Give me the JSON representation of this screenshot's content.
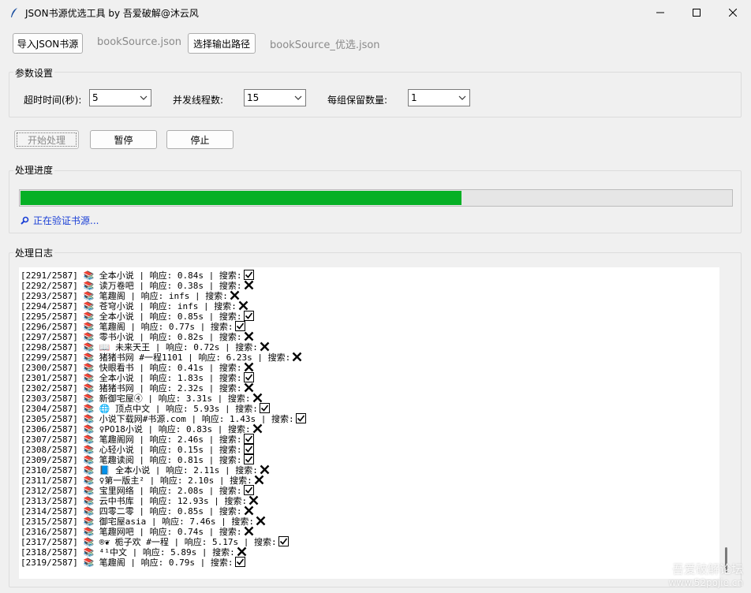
{
  "window": {
    "title": "JSON书源优选工具 by 吾爱破解@沐云风"
  },
  "toolbar": {
    "import_label": "导入JSON书源",
    "input_file": "bookSource.json",
    "output_label": "选择输出路径",
    "output_file": "bookSource_优选.json"
  },
  "params": {
    "group_title": "参数设置",
    "timeout_label": "超时时间(秒):",
    "timeout_value": "5",
    "threads_label": "并发线程数:",
    "threads_value": "15",
    "keep_label": "每组保留数量:",
    "keep_value": "1"
  },
  "controls": {
    "start_label": "开始处理",
    "pause_label": "暂停",
    "stop_label": "停止"
  },
  "progress": {
    "group_title": "处理进度",
    "fraction": 0.619,
    "status_text": "正在验证书源...",
    "accent": "#06b025"
  },
  "log": {
    "group_title": "处理日志",
    "lines": [
      {
        "text": "[2291/2587] 📚 全本小说 | 响应: 0.84s | 搜索:",
        "ok": true
      },
      {
        "text": "[2292/2587] 📚 读万卷吧 | 响应: 0.38s | 搜索:",
        "ok": false
      },
      {
        "text": "[2293/2587] 📚 笔趣阁 | 响应: infs | 搜索:",
        "ok": false
      },
      {
        "text": "[2294/2587] 📚 苍穹小说 | 响应: infs | 搜索:",
        "ok": false
      },
      {
        "text": "[2295/2587] 📚 全本小说 | 响应: 0.85s | 搜索:",
        "ok": true
      },
      {
        "text": "[2296/2587] 📚 笔趣阁 | 响应: 0.77s | 搜索:",
        "ok": true
      },
      {
        "text": "[2297/2587] 📚 零书小说 | 响应: 0.82s | 搜索:",
        "ok": false
      },
      {
        "text": "[2298/2587] 📚 📖 未来天王 | 响应: 0.72s | 搜索:",
        "ok": false
      },
      {
        "text": "[2299/2587] 📚 猪猪书网 #一程1101 | 响应: 6.23s | 搜索:",
        "ok": false
      },
      {
        "text": "[2300/2587] 📚 快眼看书 | 响应: 0.41s | 搜索:",
        "ok": false
      },
      {
        "text": "[2301/2587] 📚 全本小说 | 响应: 1.83s | 搜索:",
        "ok": true
      },
      {
        "text": "[2302/2587] 📚 猪猪书网 | 响应: 2.32s | 搜索:",
        "ok": false
      },
      {
        "text": "[2303/2587] 📚 新御宅屋④ | 响应: 3.31s | 搜索:",
        "ok": false
      },
      {
        "text": "[2304/2587] 📚 🌐 顶点中文 | 响应: 5.93s | 搜索:",
        "ok": true
      },
      {
        "text": "[2305/2587] 📚 小说下载网#书源.com | 响应: 1.43s | 搜索:",
        "ok": true
      },
      {
        "text": "[2306/2587] 📚 ♀PO18小说 | 响应: 0.83s | 搜索:",
        "ok": false
      },
      {
        "text": "[2307/2587] 📚 笔趣阁网 | 响应: 2.46s | 搜索:",
        "ok": true
      },
      {
        "text": "[2308/2587] 📚 心轻小说 | 响应: 0.15s | 搜索:",
        "ok": true
      },
      {
        "text": "[2309/2587] 📚 笔趣读阅 | 响应: 0.81s | 搜索:",
        "ok": true
      },
      {
        "text": "[2310/2587] 📚 📘 全本小说 | 响应: 2.11s | 搜索:",
        "ok": false
      },
      {
        "text": "[2311/2587] 📚 ♀第一版主² | 响应: 2.10s | 搜索:",
        "ok": false
      },
      {
        "text": "[2312/2587] 📚 宝里网络 | 响应: 2.08s | 搜索:",
        "ok": true
      },
      {
        "text": "[2313/2587] 📚 云中书库 | 响应: 12.93s | 搜索:",
        "ok": false
      },
      {
        "text": "[2314/2587] 📚 四零二零 | 响应: 0.85s | 搜索:",
        "ok": false
      },
      {
        "text": "[2315/2587] 📚 御宅屋asia | 响应: 7.46s | 搜索:",
        "ok": false
      },
      {
        "text": "[2316/2587] 📚 笔趣网吧 | 响应: 0.74s | 搜索:",
        "ok": false
      },
      {
        "text": "[2317/2587] 📚 ®❦ 栀子欢 #一程 | 响应: 5.17s | 搜索:",
        "ok": true
      },
      {
        "text": "[2318/2587] 📚 ⁴¹中文 | 响应: 5.89s | 搜索:",
        "ok": false
      },
      {
        "text": "[2319/2587] 📚 笔趣阁 | 响应: 0.79s | 搜索:",
        "ok": true
      }
    ]
  },
  "watermark": {
    "line1": "吾爱破解论坛",
    "line2": "www.52pojie.cn"
  }
}
